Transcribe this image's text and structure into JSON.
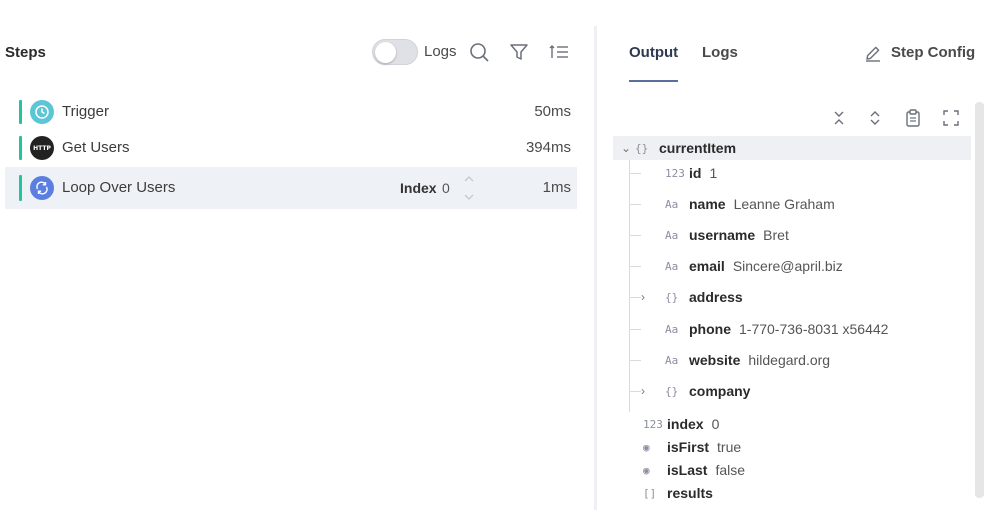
{
  "steps_panel": {
    "title": "Steps",
    "logs_toggle_label": "Logs",
    "steps": [
      {
        "name": "Trigger",
        "duration": "50ms",
        "icon": "clock-icon",
        "icon_bg": "#5cc6d6"
      },
      {
        "name": "Get Users",
        "duration": "394ms",
        "icon": "http-icon",
        "icon_bg": "#222222",
        "icon_text": "HTTP"
      },
      {
        "name": "Loop Over Users",
        "duration": "1ms",
        "icon": "loop-icon",
        "icon_bg": "#5b7fe0",
        "index_label": "Index",
        "index_value": "0"
      }
    ]
  },
  "output_panel": {
    "tabs": [
      {
        "label": "Output"
      },
      {
        "label": "Logs"
      }
    ],
    "step_config_label": "Step Config",
    "tree": {
      "root_key": "currentItem",
      "fields": [
        {
          "type": "123",
          "key": "id",
          "value": "1"
        },
        {
          "type": "Aa",
          "key": "name",
          "value": "Leanne Graham"
        },
        {
          "type": "Aa",
          "key": "username",
          "value": "Bret"
        },
        {
          "type": "Aa",
          "key": "email",
          "value": "Sincere@april.biz"
        },
        {
          "type": "{}",
          "key": "address",
          "value": ""
        },
        {
          "type": "Aa",
          "key": "phone",
          "value": "1-770-736-8031 x56442"
        },
        {
          "type": "Aa",
          "key": "website",
          "value": "hildegard.org"
        },
        {
          "type": "{}",
          "key": "company",
          "value": ""
        }
      ],
      "siblings": [
        {
          "type": "123",
          "key": "index",
          "value": "0"
        },
        {
          "type": "toggle",
          "key": "isFirst",
          "value": "true"
        },
        {
          "type": "toggle",
          "key": "isLast",
          "value": "false"
        },
        {
          "type": "[]",
          "key": "results",
          "value": ""
        }
      ]
    }
  },
  "colors": {
    "accent": "#22c49b",
    "tab_active": "#5b6e9c"
  }
}
